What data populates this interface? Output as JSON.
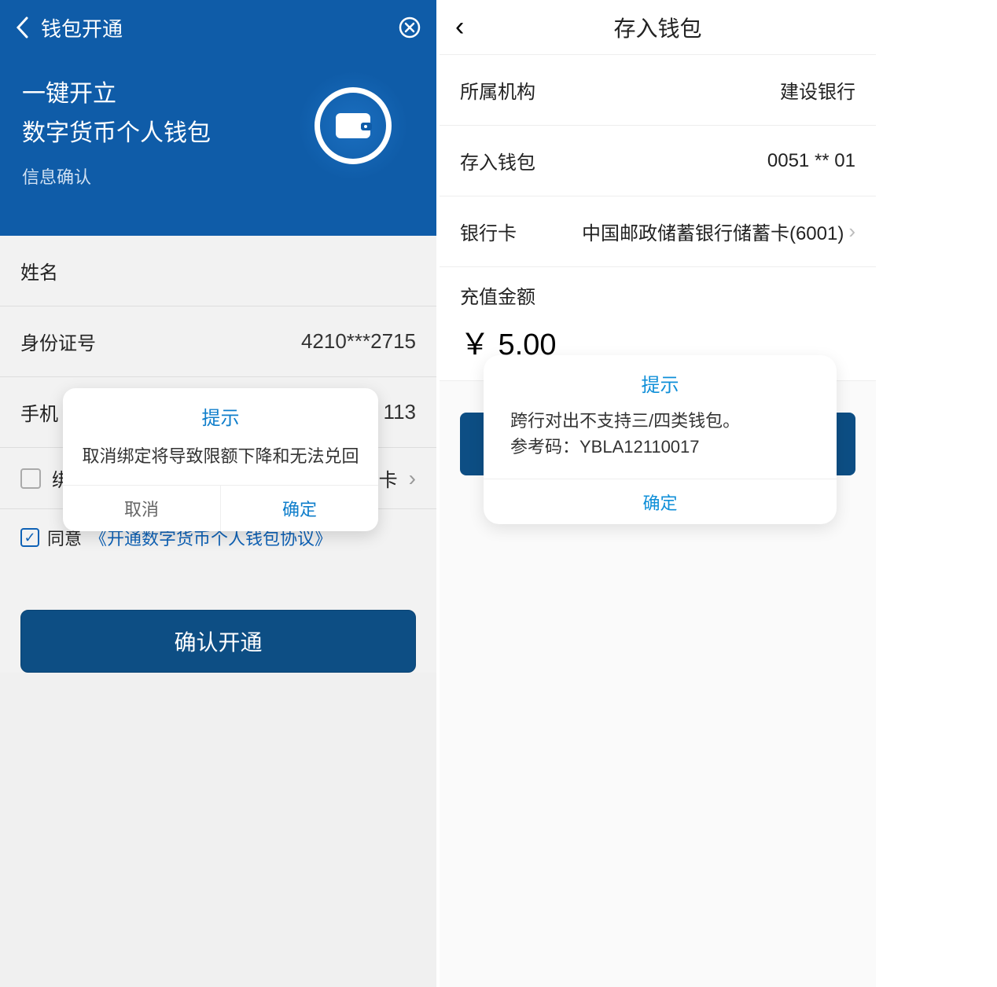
{
  "left": {
    "topbar": {
      "title": "钱包开通"
    },
    "hero": {
      "line1": "一键开立",
      "line2": "数字货币个人钱包",
      "sub": "信息确认"
    },
    "form": {
      "name_label": "姓名",
      "id_label": "身份证号",
      "id_value": "4210***2715",
      "phone_label": "手机",
      "phone_value": "113",
      "bind_label": "绑",
      "bind_tail": "卡"
    },
    "agree": {
      "prefix": "同意",
      "link": "《开通数字货币个人钱包协议》"
    },
    "confirm_btn": "确认开通",
    "dialog": {
      "title": "提示",
      "message": "取消绑定将导致限额下降和无法兑回",
      "cancel": "取消",
      "ok": "确定"
    }
  },
  "right": {
    "topbar": {
      "title": "存入钱包"
    },
    "rows": {
      "org": {
        "label": "所属机构",
        "value": "建设银行"
      },
      "wallet": {
        "label": "存入钱包",
        "value": "0051 ** 01"
      },
      "card": {
        "label": "银行卡",
        "value": "中国邮政储蓄银行储蓄卡(6001)"
      }
    },
    "amount": {
      "label": "充值金额",
      "value": "￥ 5.00"
    },
    "dialog": {
      "title": "提示",
      "line1": "跨行对出不支持三/四类钱包。",
      "line2": "参考码：YBLA12110017",
      "ok": "确定"
    }
  }
}
